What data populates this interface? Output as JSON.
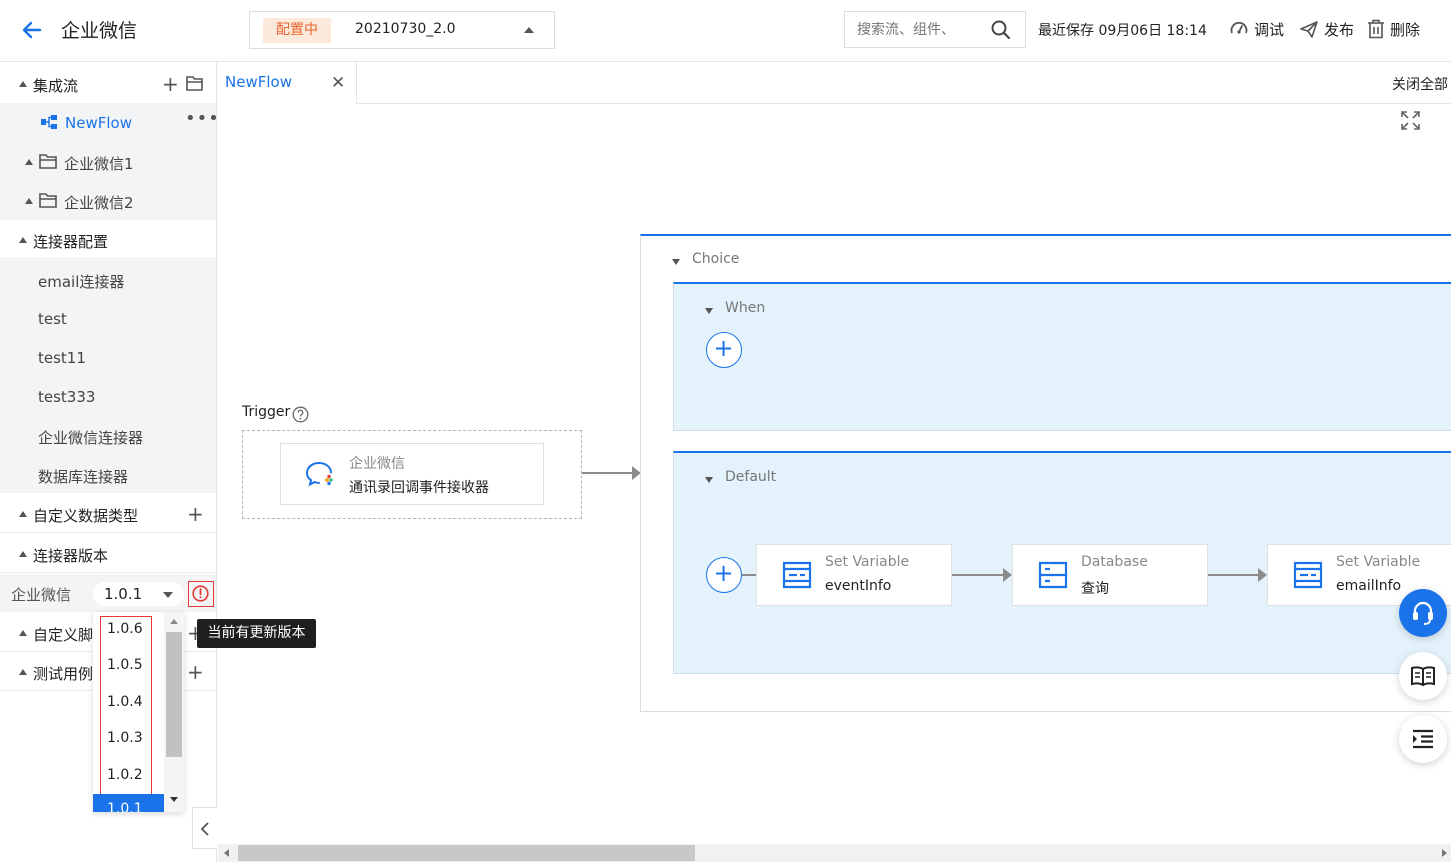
{
  "header": {
    "title": "企业微信",
    "version_status": "配置中",
    "version_value": "20210730_2.0",
    "search_placeholder": "搜索流、组件、",
    "last_saved": "最近保存 09月06日 18:14",
    "debug_label": "调试",
    "publish_label": "发布",
    "delete_label": "删除"
  },
  "sidebar": {
    "integration_flow": "集成流",
    "flow_item": "NewFlow",
    "folders": [
      "企业微信1",
      "企业微信2"
    ],
    "connector_config": "连接器配置",
    "connectors": [
      "email连接器",
      "test",
      "test11",
      "test333",
      "企业微信连接器",
      "数据库连接器"
    ],
    "custom_data_type": "自定义数据类型",
    "connector_version": "连接器版本",
    "cv_name": "企业微信",
    "cv_value": "1.0.1",
    "custom_script": "自定义脚本",
    "test_cases": "测试用例"
  },
  "dropdown": {
    "options": [
      "1.0.6",
      "1.0.5",
      "1.0.4",
      "1.0.3",
      "1.0.2",
      "1.0.1"
    ],
    "selected": "1.0.1",
    "tooltip": "当前有更新版本"
  },
  "tabs": {
    "active": "NewFlow",
    "close_all": "关闭全部"
  },
  "canvas": {
    "trigger_label": "Trigger",
    "trigger_node": {
      "t1": "企业微信",
      "t2": "通讯录回调事件接收器"
    },
    "choice_label": "Choice",
    "when_label": "When",
    "default_label": "Default",
    "nodes": [
      {
        "t1": "Set Variable",
        "t2": "eventInfo"
      },
      {
        "t1": "Database",
        "t2": "查询"
      },
      {
        "t1": "Set Variable",
        "t2": "emailInfo"
      }
    ]
  },
  "colors": {
    "accent": "#1a73e8",
    "status_bg": "#fde8dc",
    "status_text": "#e8652f",
    "block_bg": "#e3f2fb"
  }
}
